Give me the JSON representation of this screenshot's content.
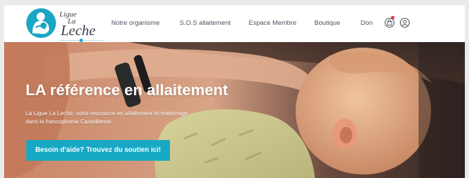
{
  "header": {
    "logo": {
      "line1": "Ligue",
      "line2": "La",
      "line3": "Leche"
    },
    "nav": [
      {
        "label": "Notre organisme"
      },
      {
        "label": "S.O.S allaitement"
      },
      {
        "label": "Espace Membre"
      },
      {
        "label": "Boutique"
      },
      {
        "label": "Don"
      }
    ],
    "icons": {
      "cart": "shopping-bag-icon",
      "account": "user-icon"
    }
  },
  "hero": {
    "title": "LA référence en allaitement",
    "subtitle": "La Ligue La Leche, votre ressource en allaitement et maternage dans la francophonie Canadienne.",
    "cta_label": "Besoin d'aide? Trouvez du soutien ici!"
  },
  "colors": {
    "brand_teal": "#1aa6c5",
    "cta_bg": "#17a8c4",
    "nav_text": "#4c5560",
    "badge": "#e0373a"
  }
}
